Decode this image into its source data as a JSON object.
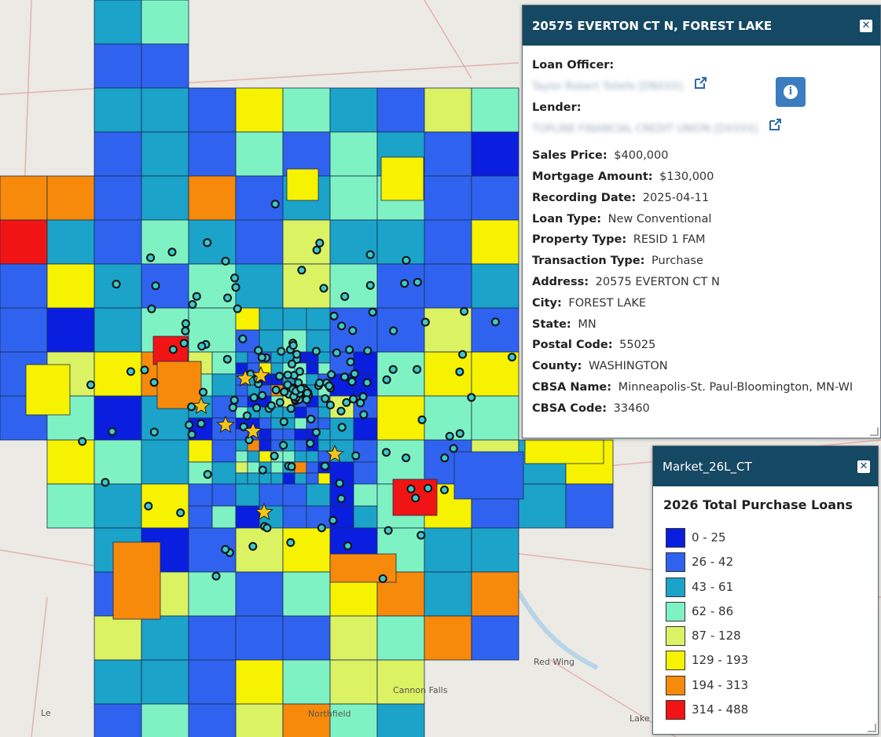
{
  "map": {
    "places": [
      {
        "name": "Red Wing"
      },
      {
        "name": "Cannon Falls"
      },
      {
        "name": "Northfield"
      },
      {
        "name": "Le"
      },
      {
        "name": "Lake"
      }
    ],
    "colors": {
      "base": "#eceae4",
      "water": "#b8d4e8",
      "road": "#e39a9a",
      "marker_fill": "#3ec8c8",
      "marker_stroke": "#111111",
      "star": "#f5c518"
    }
  },
  "popup": {
    "title": "20575 EVERTON CT N, FOREST LAKE",
    "loan_officer_label": "Loan Officer:",
    "loan_officer_value": "Taylor Robert Tollefe [DNXXX]",
    "lender_label": "Lender:",
    "lender_value": "TOPLINE FINANCIAL CREDIT UNION [DXXXX]",
    "fields": [
      {
        "label": "Sales Price:",
        "value": "$400,000"
      },
      {
        "label": "Mortgage Amount:",
        "value": "$130,000"
      },
      {
        "label": "Recording Date:",
        "value": "2025-04-11"
      },
      {
        "label": "Loan Type:",
        "value": "New Conventional"
      },
      {
        "label": "Property Type:",
        "value": "RESID 1 FAM"
      },
      {
        "label": "Transaction Type:",
        "value": "Purchase"
      },
      {
        "label": "Address:",
        "value": "20575 EVERTON CT N"
      },
      {
        "label": "City:",
        "value": "FOREST LAKE"
      },
      {
        "label": "State:",
        "value": "MN"
      },
      {
        "label": "Postal Code:",
        "value": "55025"
      },
      {
        "label": "County:",
        "value": "WASHINGTON"
      },
      {
        "label": "CBSA Name:",
        "value": "Minneapolis-St. Paul-Bloomington, MN-WI"
      },
      {
        "label": "CBSA Code:",
        "value": "33460"
      }
    ],
    "close_label": "✕",
    "info_label": "i"
  },
  "legend": {
    "title": "Market_26L_CT",
    "subtitle": "2026 Total Purchase Loans",
    "close_label": "✕",
    "items": [
      {
        "label": "0 - 25",
        "color": "#0a1ee0"
      },
      {
        "label": "26 - 42",
        "color": "#2f63ef"
      },
      {
        "label": "43 - 61",
        "color": "#1ba3c9"
      },
      {
        "label": "62 - 86",
        "color": "#7ff2c4"
      },
      {
        "label": "87 - 128",
        "color": "#dbf263"
      },
      {
        "label": "129 - 193",
        "color": "#f7f200"
      },
      {
        "label": "194 - 313",
        "color": "#f78a0a"
      },
      {
        "label": "314 - 488",
        "color": "#f01414"
      }
    ]
  }
}
